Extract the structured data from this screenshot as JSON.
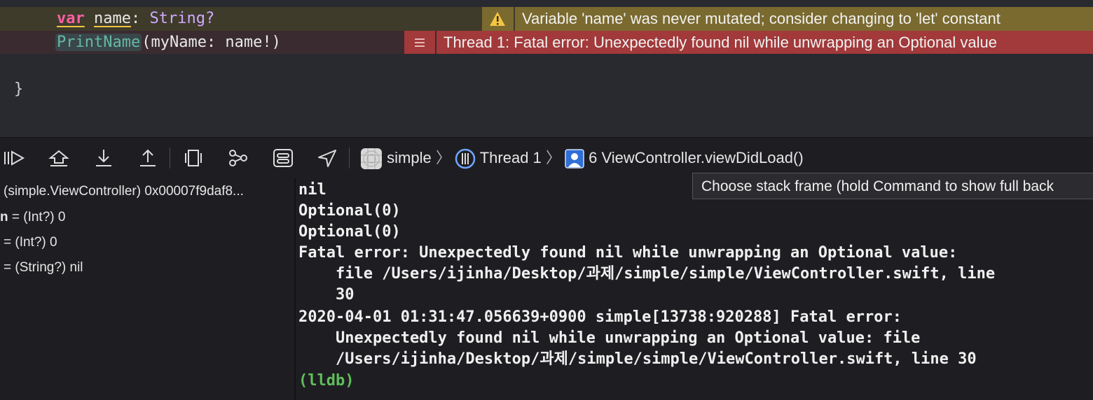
{
  "editor": {
    "line1": {
      "kw": "var",
      "name": "name",
      "rest": ": ",
      "type": "String?"
    },
    "line2": {
      "fn": "PrintName",
      "args": "(myName: name!)"
    },
    "brace": "}",
    "warning": "Variable 'name' was never mutated; consider changing to 'let' constant",
    "error": "Thread 1: Fatal error: Unexpectedly found nil while unwrapping an Optional value",
    "colors": {
      "warning_bg": "#7a6a2f",
      "error_bg": "#a2393a",
      "keyword": "#fc5fa3",
      "type": "#d0a8ff",
      "function": "#67b7a4"
    }
  },
  "debugbar": {
    "icons": [
      "continue-icon",
      "step-over-icon",
      "step-into-icon",
      "step-out-icon",
      "view-hierarchy-icon",
      "memory-graph-icon",
      "environment-overrides-icon",
      "simulate-location-icon"
    ],
    "crumbs": {
      "app": "simple",
      "thread": "Thread 1",
      "frame": "6 ViewController.viewDidLoad()"
    },
    "tooltip": "Choose stack frame (hold Command to show full back"
  },
  "variables": [
    {
      "text": "(simple.ViewController) 0x00007f9daf8..."
    },
    {
      "name": "n",
      "text": " = (Int?) 0"
    },
    {
      "text": "= (Int?) 0"
    },
    {
      "text": "= (String?) nil"
    }
  ],
  "console": {
    "lines": [
      "nil",
      "Optional(0)",
      "Optional(0)",
      "Fatal error: Unexpectedly found nil while unwrapping an Optional value:",
      "    file /Users/ijinha/Desktop/과제/simple/simple/ViewController.swift, line",
      "    30",
      "2020-04-01 01:31:47.056639+0900 simple[13738:920288] Fatal error:",
      "    Unexpectedly found nil while unwrapping an Optional value: file",
      "    /Users/ijinha/Desktop/과제/simple/simple/ViewController.swift, line 30"
    ],
    "prompt": "(lldb)",
    "prompt_color": "#5fbf5a"
  }
}
